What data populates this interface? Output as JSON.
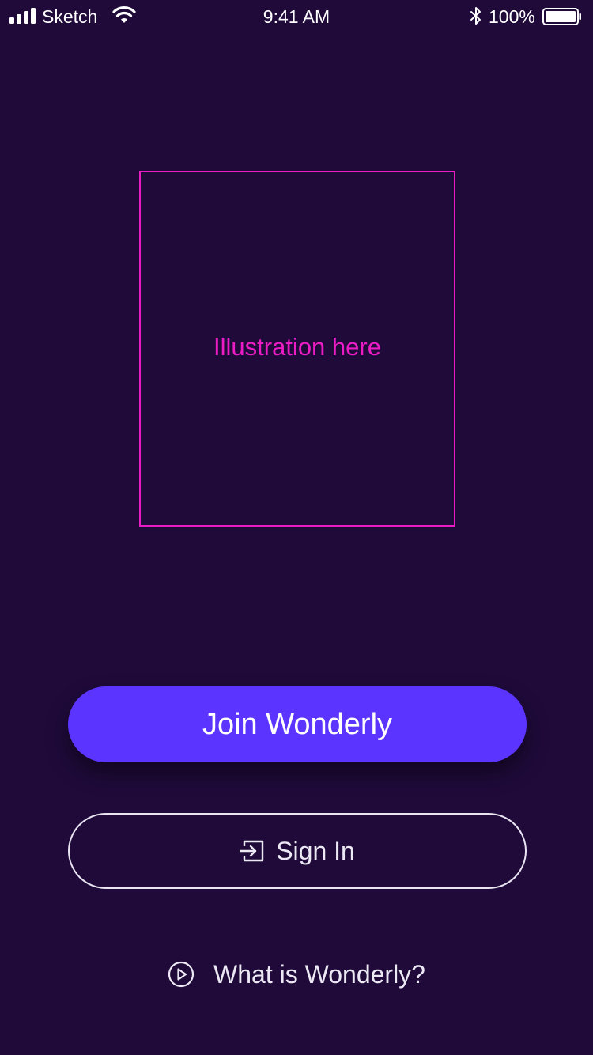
{
  "status_bar": {
    "carrier": "Sketch",
    "time": "9:41 AM",
    "battery_percent": "100%"
  },
  "illustration": {
    "label": "Illustration here"
  },
  "actions": {
    "join_label": "Join Wonderly",
    "signin_label": "Sign In",
    "what_label": "What is Wonderly?"
  },
  "icons": {
    "signal": "signal-icon",
    "wifi": "wifi-icon",
    "bluetooth": "bluetooth-icon",
    "battery": "battery-icon",
    "sign_in": "sign-in-icon",
    "play": "play-circle-icon"
  },
  "colors": {
    "background": "#1f0a3a",
    "accent": "#5b35ff",
    "placeholder": "#ec1cc4"
  }
}
